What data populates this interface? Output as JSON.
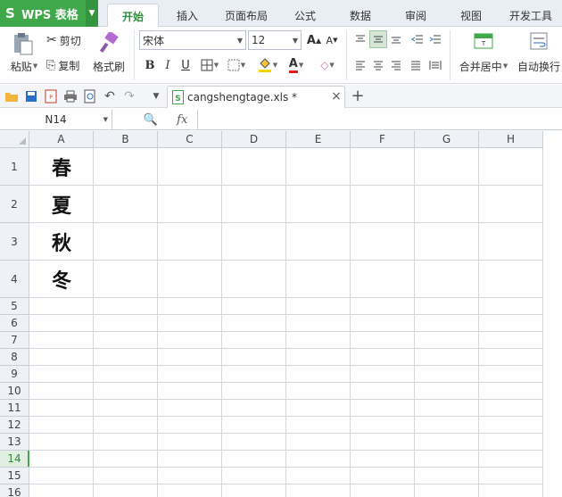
{
  "app": {
    "name": "WPS 表格",
    "logo": "S"
  },
  "tabs": [
    {
      "label": "开始",
      "active": true
    },
    {
      "label": "插入"
    },
    {
      "label": "页面布局"
    },
    {
      "label": "公式"
    },
    {
      "label": "数据"
    },
    {
      "label": "审阅"
    },
    {
      "label": "视图"
    },
    {
      "label": "开发工具"
    }
  ],
  "ribbon": {
    "paste": "粘贴",
    "cut": "剪切",
    "copy": "复制",
    "format_painter": "格式刷",
    "font_name": "宋体",
    "font_size": "12",
    "bold": "B",
    "italic": "I",
    "underline": "U",
    "merge_center": "合并居中",
    "auto_wrap": "自动换行"
  },
  "document": {
    "tab_name": "cangshengtage.xls *"
  },
  "formula_bar": {
    "cell_ref": "N14",
    "fx": "fx",
    "value": ""
  },
  "sheet": {
    "columns": [
      "A",
      "B",
      "C",
      "D",
      "E",
      "F",
      "G",
      "H"
    ],
    "rows": [
      "1",
      "2",
      "3",
      "4",
      "5",
      "6",
      "7",
      "8",
      "9",
      "10",
      "11",
      "12",
      "13",
      "14",
      "15",
      "16"
    ],
    "selected_row": "14",
    "cells": {
      "A1": "春",
      "A2": "夏",
      "A3": "秋",
      "A4": "冬"
    }
  },
  "colors": {
    "accent": "#3ea84a",
    "tab_bg": "#e9eef4",
    "header_bg": "#eef1f5",
    "grid_line": "#d4d8dd"
  }
}
